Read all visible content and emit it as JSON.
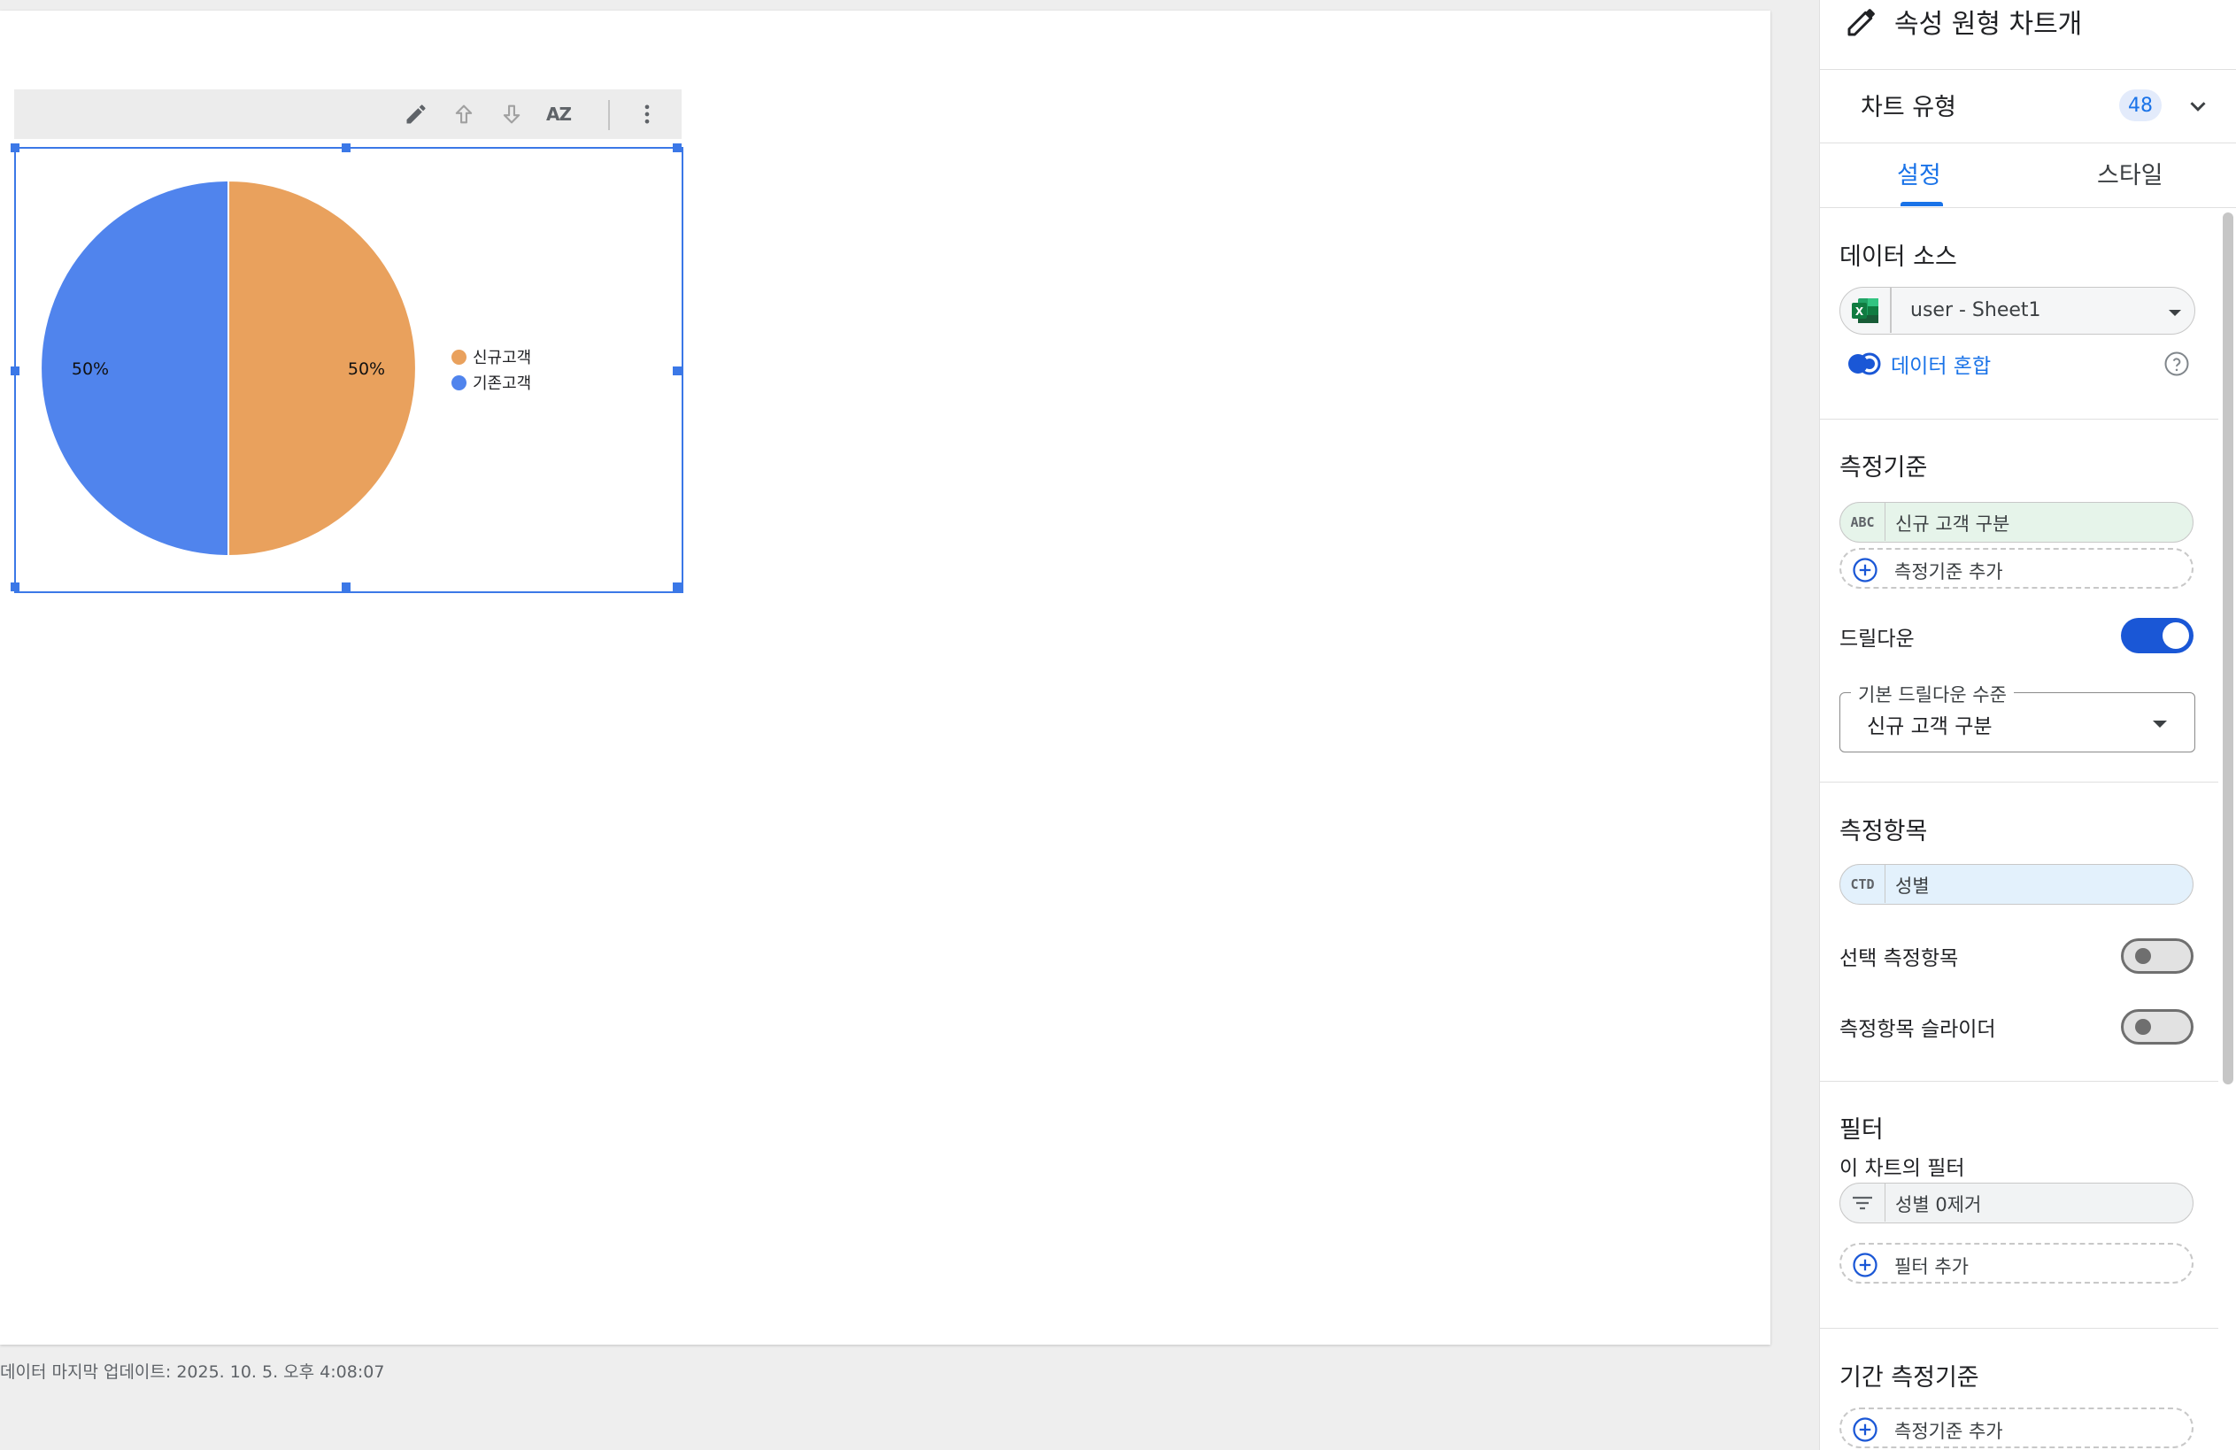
{
  "canvas": {
    "footer": "데이터 마지막 업데이트: 2025. 10. 5. 오후 4:08:07"
  },
  "chart_data": {
    "type": "pie",
    "categories": [
      "신규고객",
      "기존고객"
    ],
    "values": [
      50,
      50
    ],
    "labels": [
      "50%",
      "50%"
    ],
    "colors": [
      "#e9a15d",
      "#5084ed"
    ],
    "legend": "right",
    "title": ""
  },
  "toolbar": {
    "icons": [
      "pencil-icon",
      "arrow-up-icon",
      "arrow-down-icon",
      "sort-az-icon",
      "more-vert-icon"
    ],
    "sort_label": "AZ"
  },
  "panel": {
    "title": "속성 원형 차트개",
    "chart_type_label": "차트 유형",
    "chart_type_badge": "48",
    "tabs": [
      {
        "label": "설정",
        "active": true
      },
      {
        "label": "스타일",
        "active": false
      }
    ],
    "data_source": {
      "heading": "데이터 소스",
      "value": "user - Sheet1",
      "blend_label": "데이터 혼합"
    },
    "dimension": {
      "heading": "측정기준",
      "field_icon": "ABC",
      "field": "신규 고객 구분",
      "add_label": "측정기준 추가",
      "drilldown_label": "드릴다운",
      "drilldown_on": true,
      "default_level_label": "기본 드릴다운 수준",
      "default_level_value": "신규 고객 구분"
    },
    "metric": {
      "heading": "측정항목",
      "field_icon": "CTD",
      "field": "성별",
      "optional_label": "선택 측정항목",
      "slider_label": "측정항목 슬라이더"
    },
    "filter": {
      "heading": "필터",
      "sub_label": "이 차트의 필터",
      "field": "성별 0제거",
      "add_label": "필터 추가"
    },
    "date_dimension": {
      "heading": "기간 측정기준",
      "add_label": "측정기준 추가"
    },
    "colors": {
      "accent": "#1a73e8",
      "dimension_pill": "#e6f4ea",
      "metric_pill": "#e3f1fc",
      "filter_pill": "#f1f3f4"
    }
  }
}
